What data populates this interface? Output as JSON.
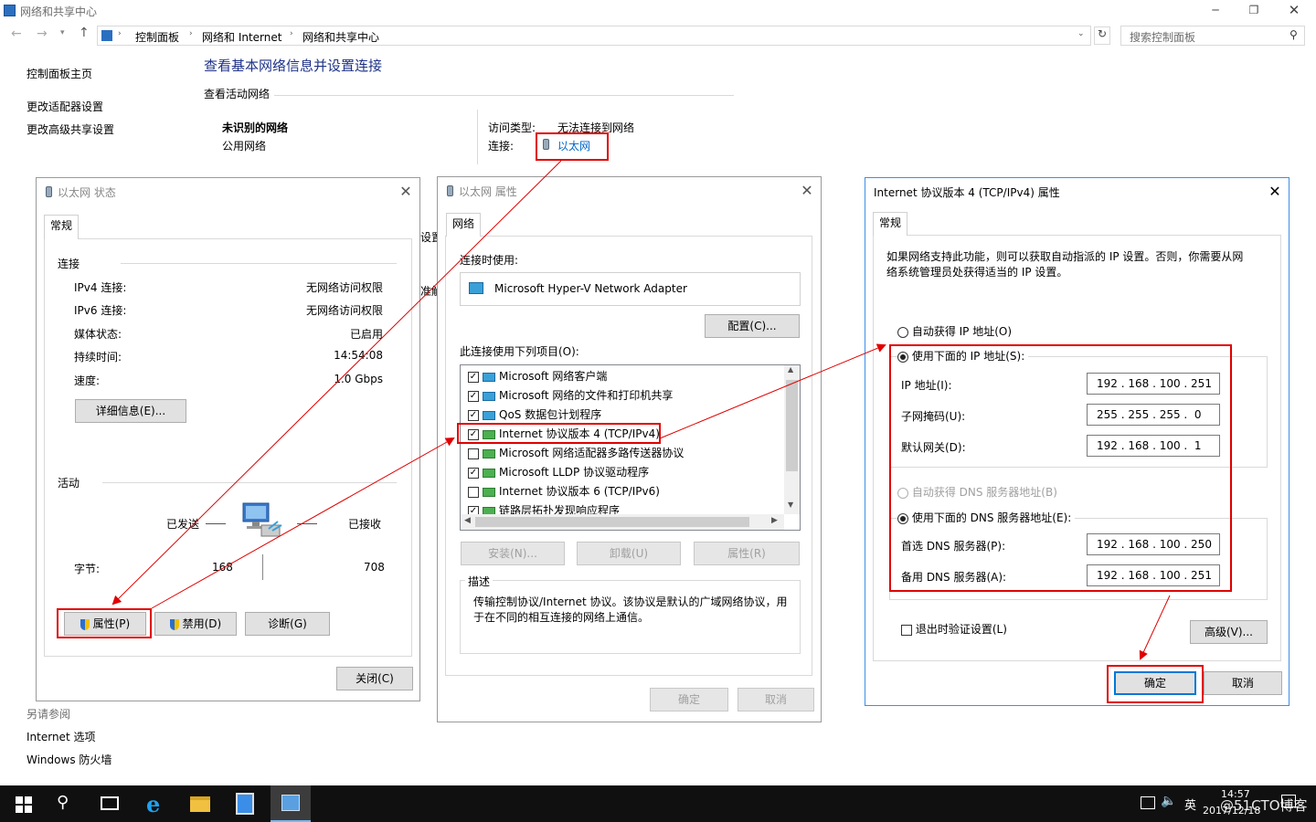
{
  "main_window": {
    "title": "网络和共享中心",
    "breadcrumb": [
      "控制面板",
      "网络和 Internet",
      "网络和共享中心"
    ],
    "search_placeholder": "搜索控制面板",
    "sidebar": [
      "控制面板主页",
      "更改适配器设置",
      "更改高级共享设置"
    ],
    "see_also_title": "另请参阅",
    "see_also": [
      "Internet 选项",
      "Windows 防火墙"
    ],
    "heading": "查看基本网络信息并设置连接",
    "active_networks_label": "查看活动网络",
    "network_name": "未识别的网络",
    "network_type": "公用网络",
    "access_type_label": "访问类型:",
    "access_type_value": "无法连接到网络",
    "connection_label": "连接:",
    "connection_value": "以太网",
    "partial_1": "设置",
    "partial_2": "准解"
  },
  "status_dialog": {
    "title": "以太网 状态",
    "tab": "常规",
    "connection_group": "连接",
    "rows": [
      {
        "label": "IPv4 连接:",
        "value": "无网络访问权限"
      },
      {
        "label": "IPv6 连接:",
        "value": "无网络访问权限"
      },
      {
        "label": "媒体状态:",
        "value": "已启用"
      },
      {
        "label": "持续时间:",
        "value": "14:54:08"
      },
      {
        "label": "速度:",
        "value": "1.0 Gbps"
      }
    ],
    "details_button": "详细信息(E)...",
    "activity_group": "活动",
    "sent_label": "已发送",
    "received_label": "已接收",
    "bytes_label": "字节:",
    "bytes_sent": "168",
    "bytes_received": "708",
    "properties_button": "属性(P)",
    "disable_button": "禁用(D)",
    "diagnose_button": "诊断(G)",
    "close_button": "关闭(C)"
  },
  "props_dialog": {
    "title": "以太网 属性",
    "tab": "网络",
    "connect_using_label": "连接时使用:",
    "adapter": "Microsoft Hyper-V Network Adapter",
    "configure_button": "配置(C)...",
    "items_label": "此连接使用下列项目(O):",
    "items": [
      {
        "label": "Microsoft 网络客户端",
        "checked": true
      },
      {
        "label": "Microsoft 网络的文件和打印机共享",
        "checked": true
      },
      {
        "label": "QoS 数据包计划程序",
        "checked": true
      },
      {
        "label": "Internet 协议版本 4 (TCP/IPv4)",
        "checked": true
      },
      {
        "label": "Microsoft 网络适配器多路传送器协议",
        "checked": false
      },
      {
        "label": "Microsoft LLDP 协议驱动程序",
        "checked": true
      },
      {
        "label": "Internet 协议版本 6 (TCP/IPv6)",
        "checked": false
      },
      {
        "label": "链路层拓扑发现响应程序",
        "checked": true
      }
    ],
    "install_button": "安装(N)...",
    "uninstall_button": "卸载(U)",
    "properties_button": "属性(R)",
    "description_label": "描述",
    "description": "传输控制协议/Internet 协议。该协议是默认的广域网络协议，用于在不同的相互连接的网络上通信。",
    "ok_button": "确定",
    "cancel_button": "取消"
  },
  "ipv4_dialog": {
    "title": "Internet 协议版本 4 (TCP/IPv4) 属性",
    "tab": "常规",
    "intro": "如果网络支持此功能，则可以获取自动指派的 IP 设置。否则，你需要从网络系统管理员处获得适当的 IP 设置。",
    "auto_ip": "自动获得 IP 地址(O)",
    "manual_ip": "使用下面的 IP 地址(S):",
    "ip_label": "IP 地址(I):",
    "ip_value": "192 . 168 . 100 . 251",
    "mask_label": "子网掩码(U):",
    "mask_value": "255 . 255 . 255 .  0",
    "gateway_label": "默认网关(D):",
    "gateway_value": "192 . 168 . 100 .  1",
    "auto_dns": "自动获得 DNS 服务器地址(B)",
    "manual_dns": "使用下面的 DNS 服务器地址(E):",
    "pref_dns_label": "首选 DNS 服务器(P):",
    "pref_dns_value": "192 . 168 . 100 . 250",
    "alt_dns_label": "备用 DNS 服务器(A):",
    "alt_dns_value": "192 . 168 . 100 . 251",
    "validate_label": "退出时验证设置(L)",
    "advanced_button": "高级(V)...",
    "ok_button": "确定",
    "cancel_button": "取消"
  },
  "taskbar": {
    "ime": "英",
    "time": "14:57",
    "date": "2017/12/18",
    "watermark": "@51CTO博客"
  }
}
